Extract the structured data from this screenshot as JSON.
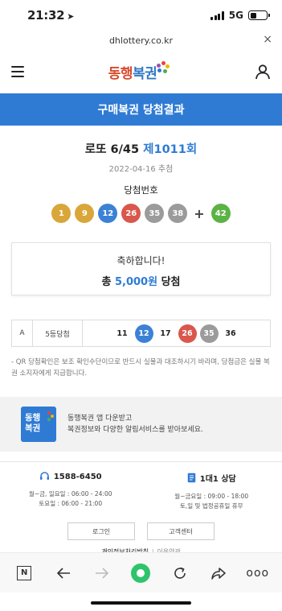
{
  "status": {
    "time": "21:32",
    "network": "5G"
  },
  "browser": {
    "url": "dhlottery.co.kr",
    "close_symbol": "×"
  },
  "header": {
    "logo_main": "동행",
    "logo_accent": "복권",
    "logo_sub": "Donghaeng Lottery"
  },
  "page": {
    "title": "구매복권 당첨결과"
  },
  "game": {
    "name": "로또 6/45",
    "round": "제1011회",
    "draw_date": "2022-04-16 추첨",
    "winning_label": "당첨번호",
    "numbers": [
      "1",
      "9",
      "12",
      "26",
      "35",
      "38"
    ],
    "ball_colors": [
      "#d9a63a",
      "#d9a63a",
      "#3b82d6",
      "#d9574c",
      "#9b9b9b",
      "#9b9b9b"
    ],
    "plus": "+",
    "bonus": "42",
    "bonus_color": "#5bb345"
  },
  "result": {
    "congrats": "축하합니다!",
    "prefix": "총",
    "amount": "5,000원",
    "suffix": "당첨"
  },
  "ticket": {
    "slot": "A",
    "rank": "5등당첨",
    "numbers": [
      "11",
      "12",
      "17",
      "26",
      "35",
      "36"
    ],
    "hits": [
      false,
      true,
      false,
      true,
      true,
      false
    ],
    "hit_colors": [
      "",
      "#3b82d6",
      "",
      "#d9574c",
      "#9b9b9b",
      ""
    ]
  },
  "notice": "- QR 당첨확인은 보조 확인수단이므로 반드시 실물과 대조하시기 바라며, 당첨금은 실물 복권 소지자에게 지급합니다.",
  "app_banner": {
    "icon_line1": "동행",
    "icon_line2": "복권",
    "line1": "동행복권 앱 다운받고",
    "line2": "복권정보와 다양한 알림서비스를 받아보세요."
  },
  "footer": {
    "phone": "1588-6450",
    "phone_hours_1": "월~금, 일요일 : 06:00 - 24:00",
    "phone_hours_2": "토요일 : 06:00 - 21:00",
    "chat": "1대1 상담",
    "chat_hours_1": "월~금요일 : 09:00 - 18:00",
    "chat_hours_2": "토,일 및 법정공휴일 휴무",
    "login": "로그인",
    "support": "고객센터",
    "privacy": "개인정보처리방침",
    "separator": "l",
    "terms": "이용약관"
  },
  "toolbar": {
    "n_label": "N",
    "more": "ooo"
  }
}
